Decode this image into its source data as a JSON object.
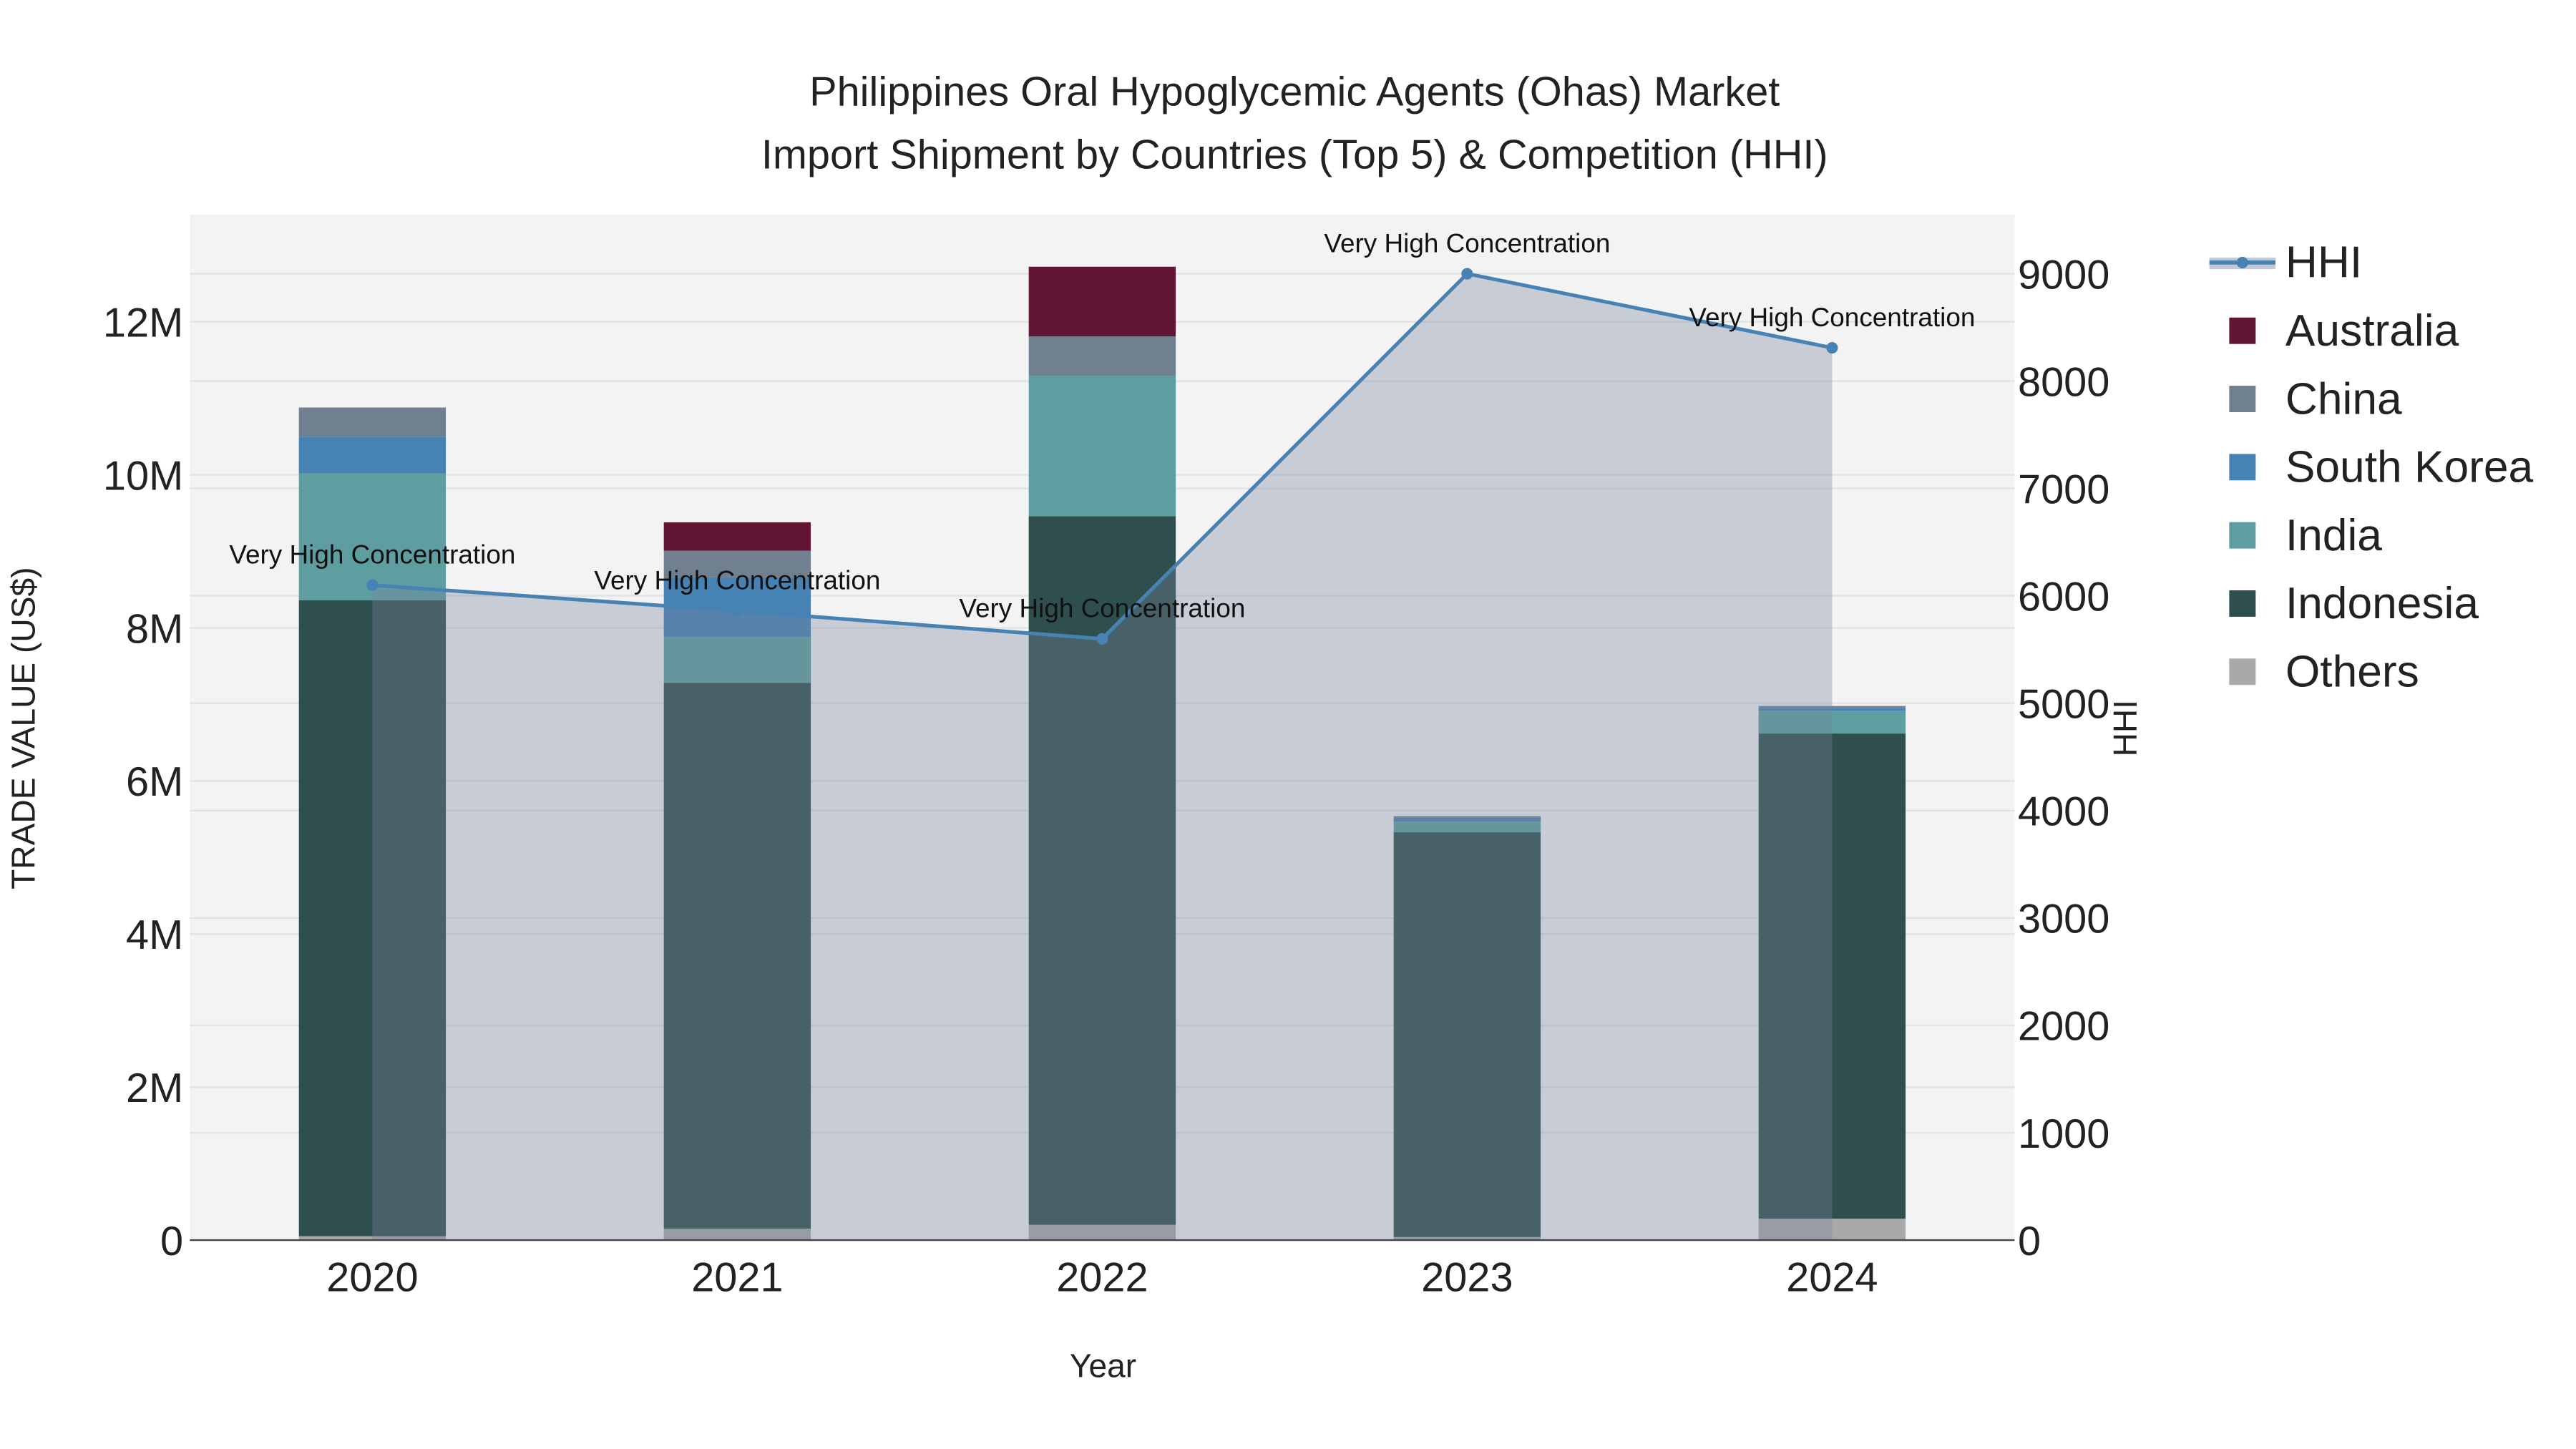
{
  "chart_data": {
    "type": "bar",
    "title_line1": "Philippines Oral Hypoglycemic Agents (Ohas) Market",
    "title_line2": "Import Shipment by Countries (Top 5) & Competition (HHI)",
    "xlabel": "Year",
    "ylabel": "TRADE VALUE (US$)",
    "y2label": "HHI",
    "categories": [
      "2020",
      "2021",
      "2022",
      "2023",
      "2024"
    ],
    "ylim": [
      0,
      13400000
    ],
    "y2lim": [
      0,
      9550
    ],
    "yticks": [
      0,
      2000000,
      4000000,
      6000000,
      8000000,
      10000000,
      12000000
    ],
    "ytick_labels": [
      "0",
      "2M",
      "4M",
      "6M",
      "8M",
      "10M",
      "12M"
    ],
    "y2ticks": [
      0,
      1000,
      2000,
      3000,
      4000,
      5000,
      6000,
      7000,
      8000,
      9000
    ],
    "y2tick_labels": [
      "0",
      "1000",
      "2000",
      "3000",
      "4000",
      "5000",
      "6000",
      "7000",
      "8000",
      "9000"
    ],
    "series": [
      {
        "name": "Others",
        "color": "#a9a9a9",
        "values": [
          50000,
          150000,
          200000,
          40000,
          280000
        ]
      },
      {
        "name": "Indonesia",
        "color": "#2f4f4f",
        "values": [
          8310000,
          7130000,
          9260000,
          5290000,
          6340000
        ]
      },
      {
        "name": "India",
        "color": "#5f9ea0",
        "values": [
          1660000,
          600000,
          1830000,
          140000,
          300000
        ]
      },
      {
        "name": "South Korea",
        "color": "#4682b4",
        "values": [
          480000,
          780000,
          0,
          50000,
          30000
        ]
      },
      {
        "name": "China",
        "color": "#708090",
        "values": [
          380000,
          350000,
          520000,
          20000,
          30000
        ]
      },
      {
        "name": "Australia",
        "color": "#611434",
        "values": [
          0,
          370000,
          910000,
          0,
          0
        ]
      }
    ],
    "hhi": {
      "name": "HHI",
      "color": "#4682b4",
      "values": [
        6100,
        5860,
        5600,
        9000,
        8310
      ],
      "annotations": [
        "Very High Concentration",
        "Very High Concentration",
        "Very High Concentration",
        "Very High Concentration",
        "Very High Concentration"
      ]
    },
    "legend": [
      "HHI",
      "Australia",
      "China",
      "South Korea",
      "India",
      "Indonesia",
      "Others"
    ],
    "legend_position": "right",
    "grid": true
  }
}
